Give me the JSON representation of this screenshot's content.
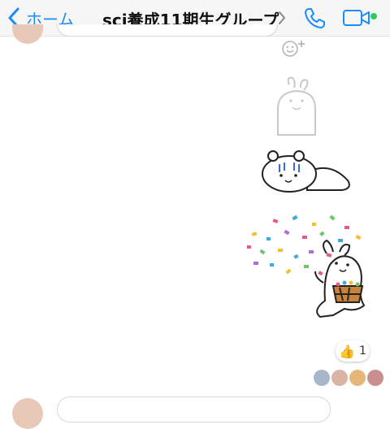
{
  "header": {
    "back_label": "ホーム",
    "title": "sci養成11期生グループ",
    "icons": [
      "chevron-left-icon",
      "chevron-right-icon",
      "phone-icon",
      "video-camera-icon"
    ],
    "online_color": "#31c85a",
    "accent_color": "#1a8cff"
  },
  "reaction": {
    "emoji": "👍",
    "count": "1"
  },
  "seen_by_count": 4
}
